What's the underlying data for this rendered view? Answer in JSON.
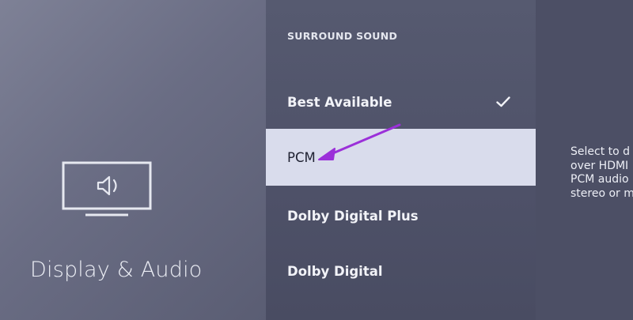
{
  "category": {
    "icon": "display-audio-tv-icon",
    "title": "Display & Audio"
  },
  "menu": {
    "header": "SURROUND SOUND",
    "items": [
      {
        "label": "Best Available",
        "selected": true,
        "focused": false
      },
      {
        "label": "PCM",
        "selected": false,
        "focused": true
      },
      {
        "label": "Dolby Digital Plus",
        "selected": false,
        "focused": false
      },
      {
        "label": "Dolby Digital",
        "selected": false,
        "focused": false
      }
    ]
  },
  "description": {
    "text": "Select to d\nover HDMI\nPCM audio\nstereo or m"
  },
  "colors": {
    "focus_highlight": "#d9dcec",
    "annotation_arrow": "#9b30d9"
  }
}
